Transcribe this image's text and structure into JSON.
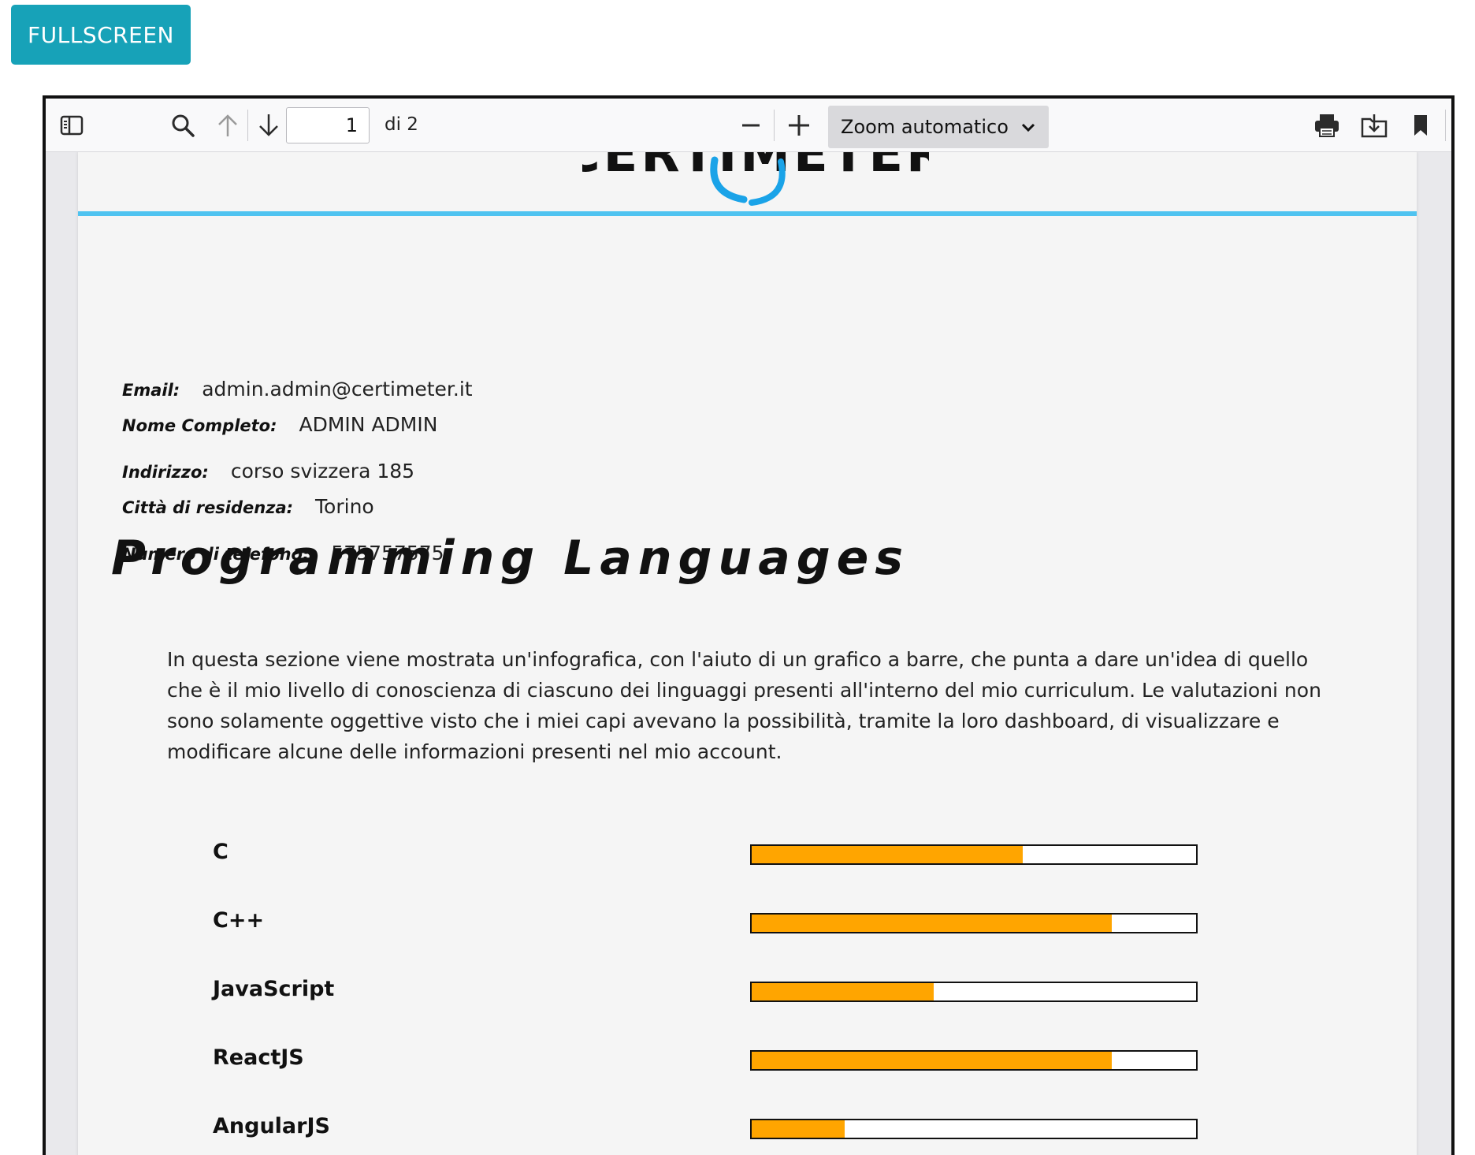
{
  "fullscreen_button": {
    "label": "FULLSCREEN",
    "color": "#17a2b8"
  },
  "pdf_toolbar": {
    "sidebar_icon": "sidebar-toggle-icon",
    "search_icon": "search-icon",
    "prev_icon": "arrow-up-icon",
    "next_icon": "arrow-down-icon",
    "page_number": "1",
    "page_count": "di 2",
    "zoom_out_icon": "minus-icon",
    "zoom_in_icon": "plus-icon",
    "zoom_value": "Zoom automatico",
    "print_icon": "printer-icon",
    "download_icon": "download-icon",
    "bookmark_icon": "bookmark-icon",
    "tools_icon": "double-chevron-icon"
  },
  "document": {
    "logo_text": "CERTIMETER",
    "accent_color": "#4fc3f0",
    "fields": [
      {
        "key": "Email:",
        "value": "admin.admin@certimeter.it"
      },
      {
        "key": "Nome Completo:",
        "value": "ADMIN ADMIN"
      },
      {
        "key": "Indirizzo:",
        "value": "corso svizzera 185"
      },
      {
        "key": "Città di residenza:",
        "value": "Torino"
      },
      {
        "key": "Numero di telefono:",
        "value": "575757575"
      }
    ],
    "section_title": "Programming Languages",
    "description": "In questa sezione viene mostrata un'infografica, con l'aiuto di un grafico a barre, che punta a dare un'idea di quello che è il mio livello di conoscienza di ciascuno dei linguaggi presenti all'interno del mio curriculum. Le valutazioni non sono solamente oggettive visto che i miei capi avevano la possibilità, tramite la loro dashboard, di visualizzare e modificare alcune delle informazioni presenti nel mio account.",
    "bar_color": "#ffa500",
    "skills": [
      {
        "name": "C",
        "level": 0.61
      },
      {
        "name": "C++",
        "level": 0.81
      },
      {
        "name": "JavaScript",
        "level": 0.41
      },
      {
        "name": "ReactJS",
        "level": 0.81
      },
      {
        "name": "AngularJS",
        "level": 0.21
      }
    ]
  }
}
